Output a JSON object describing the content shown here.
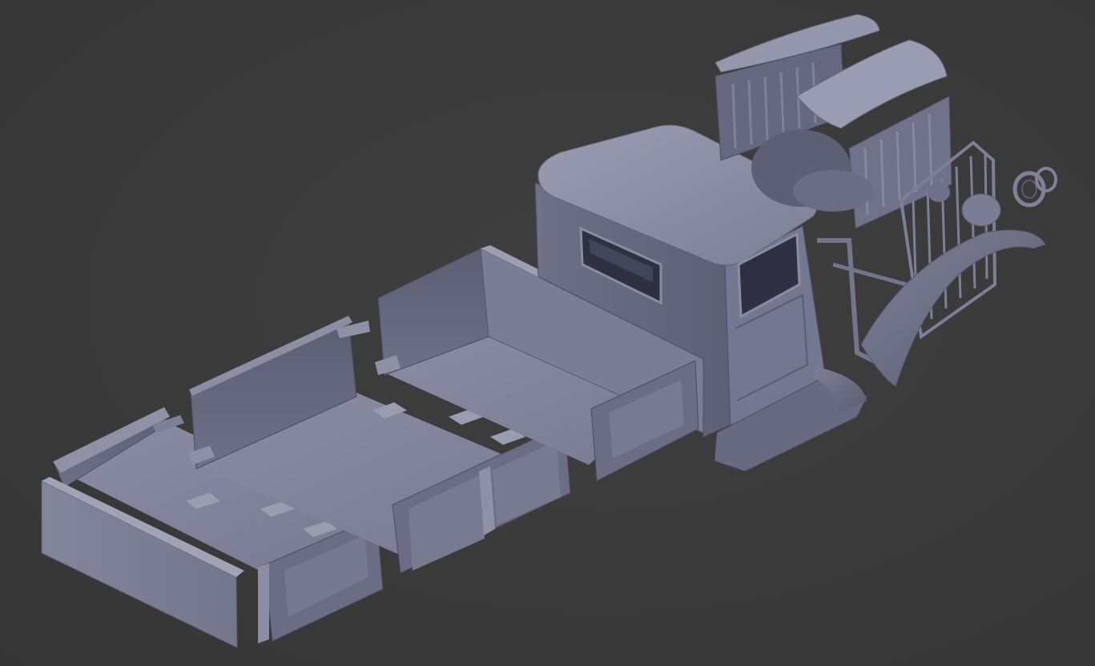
{
  "scene": {
    "description_visible_text": "",
    "colors": {
      "background": "#3b3b3b",
      "model_light": "#8b8ea4",
      "model_mid": "#6f7288",
      "model_dark": "#545669",
      "model_shadow": "#3f4152",
      "window_dark": "#2e3040"
    },
    "parts": [
      {
        "id": "cargo-bed-rear-section",
        "icon": "box-icon"
      },
      {
        "id": "cargo-bed-middle-section",
        "icon": "box-icon"
      },
      {
        "id": "cargo-bed-front-section",
        "icon": "box-icon"
      },
      {
        "id": "truck-cab",
        "icon": "cab-icon"
      },
      {
        "id": "hood-panels",
        "icon": "hood-icon"
      },
      {
        "id": "radiator-grille",
        "icon": "grille-icon"
      },
      {
        "id": "front-fender",
        "icon": "fender-icon"
      },
      {
        "id": "headlight-rings",
        "icon": "ring-icon"
      }
    ]
  }
}
